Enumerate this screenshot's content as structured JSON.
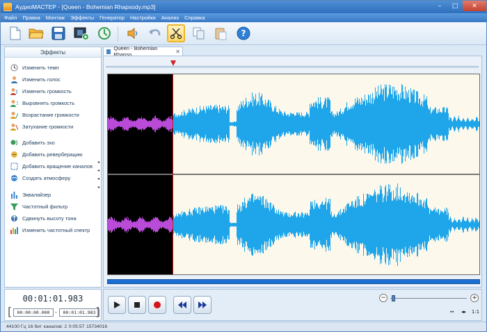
{
  "window": {
    "title": "АудиоМАСТЕР - [Queen - Bohemian Rhapsody.mp3]",
    "controls": {
      "minimize": "–",
      "maximize": "□",
      "close": "✕"
    }
  },
  "menu": [
    "Файл",
    "Правка",
    "Монтаж",
    "Эффекты",
    "Генератор",
    "Настройки",
    "Анализ",
    "Справка"
  ],
  "toolbar": {
    "buttons": [
      "new-file-icon",
      "open-folder-icon",
      "save-icon",
      "film-icon",
      "refresh-icon",
      "volume-icon",
      "undo-icon",
      "cut-icon",
      "copy-icon",
      "paste-icon",
      "help-icon"
    ],
    "active": "cut-icon",
    "help_label": "?"
  },
  "effects": {
    "header": "Эффекты",
    "items": [
      "Изменить темп",
      "Изменить голос",
      "Изменить громкость",
      "Выровнять громкость",
      "Возрастание громкости",
      "Затухание громкости",
      "Добавить эхо",
      "Добавить реверберацию",
      "Добавить вращение каналов",
      "Создать атмосферу",
      "Эквалайзер",
      "Частотный фильтр",
      "Сдвинуть высоту тона",
      "Изменить частотный спектр"
    ]
  },
  "document_tab": {
    "label": "Queen - Bohemian Rhapso...",
    "close": "✕"
  },
  "time": {
    "current": "00:01:01.983",
    "start": "00:00:00.000",
    "end": "00:01:01.983",
    "separator": "-",
    "bracket_open": "[",
    "bracket_close": "]"
  },
  "transport": {
    "zoom_minus": "−",
    "zoom_plus": "+",
    "fit_h": "↔",
    "fit_v": "◂▸",
    "ratio": "1:1"
  },
  "status": {
    "sample_rate": "44100 Гц",
    "bits": "16 бит",
    "channels": "каналов: 2",
    "duration": "0:05:57",
    "samples": "15734016"
  },
  "colors": {
    "selected_wave": "#b94bd8",
    "wave": "#1fa6ea",
    "selection_bg": "#000000",
    "wave_bg": "#fcf8ec",
    "playhead": "#cc1a1a"
  }
}
